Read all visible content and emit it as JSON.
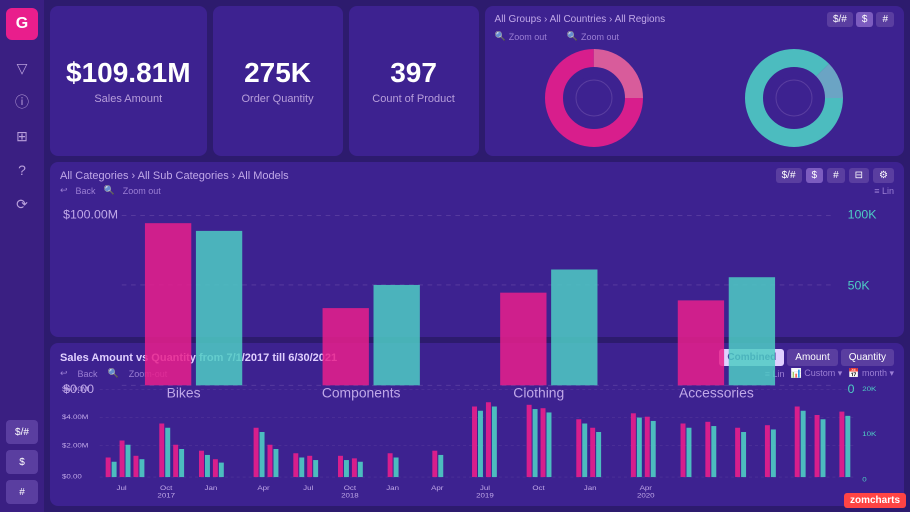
{
  "sidebar": {
    "logo": "G",
    "icons": [
      "filter",
      "info",
      "grid",
      "question",
      "refresh"
    ],
    "bottom_buttons": [
      "$/#",
      "$",
      "#"
    ]
  },
  "kpi": [
    {
      "value": "$109.81M",
      "label": "Sales Amount"
    },
    {
      "value": "275K",
      "label": "Order Quantity"
    },
    {
      "value": "397",
      "label": "Count of Product"
    }
  ],
  "pie_area": {
    "breadcrumb": "All Groups › All Countries › All Regions",
    "buttons": [
      "$/#",
      "$",
      "#"
    ],
    "zoom_labels": [
      "Zoom out",
      "Zoom out"
    ]
  },
  "bar_chart": {
    "breadcrumb": "All Categories › All Sub Categories › All Models",
    "buttons": [
      "$/#",
      "$",
      "#"
    ],
    "nav": [
      "Back",
      "Zoom out",
      "Lin"
    ],
    "categories": [
      "Bikes",
      "Components",
      "Clothing",
      "Accessories"
    ],
    "y_left": [
      "$100.00M",
      "$0.00"
    ],
    "y_right": [
      "100K",
      "50K",
      "0"
    ]
  },
  "bottom_chart": {
    "title": "Sales Amount vs Quantity from 7/1/2017 till 6/30/2021",
    "buttons": [
      "Combined",
      "Amount",
      "Quantity"
    ],
    "active_button": "Combined",
    "nav_right": [
      "Lin",
      "Custom ▾",
      "month ▾"
    ],
    "x_labels": [
      "Jul",
      "Oct\n2017",
      "Jan",
      "Apr",
      "Jul",
      "Oct\n2018",
      "Jan",
      "Apr",
      "Jul\n2019",
      "Oct",
      "Jan",
      "Apr\n2020"
    ],
    "y_left": [
      "$6.00M",
      "$4.00M",
      "$2.00M",
      "$0.00"
    ],
    "y_right": [
      "20K",
      "10K",
      "0"
    ]
  },
  "watermark": "zomcharts"
}
